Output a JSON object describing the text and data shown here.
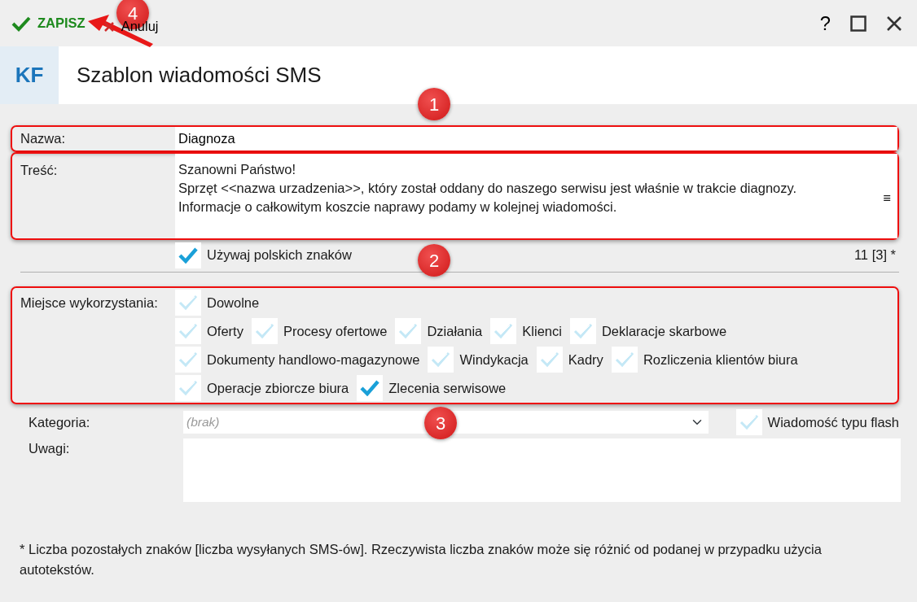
{
  "toolbar": {
    "save": "ZAPISZ",
    "cancel": "Anuluj",
    "help": "?"
  },
  "header": {
    "badge": "KF",
    "title": "Szablon wiadomości SMS"
  },
  "form": {
    "name": {
      "label": "Nazwa:",
      "value": "Diagnoza",
      "framed": true
    },
    "content": {
      "label": "Treść:",
      "lines": [
        "Szanowni Państwo!",
        "Sprzęt <<nazwa urzadzenia>>, który został oddany do naszego serwisu jest właśnie w trakcie diagnozy.",
        "Informacje o całkowitym koszcie naprawy podamy w kolejnej wiadomości."
      ],
      "menu_glyph": "≡",
      "framed": true
    },
    "polish_chars": {
      "label": "Używaj polskich znaków",
      "checked": true
    },
    "counter": "11 [3] *",
    "usage": {
      "label": "Miejsce wykorzystania:",
      "framed": true,
      "lines": [
        {
          "options": [
            {
              "label": "Dowolne",
              "checked": false
            }
          ]
        },
        {
          "options": [
            {
              "label": "Oferty",
              "checked": false
            },
            {
              "label": "Procesy ofertowe",
              "checked": false
            },
            {
              "label": "Działania",
              "checked": false
            },
            {
              "label": "Klienci",
              "checked": false
            },
            {
              "label": "Deklaracje skarbowe",
              "checked": false
            }
          ]
        },
        {
          "options": [
            {
              "label": "Dokumenty handlowo-magazynowe",
              "checked": false
            },
            {
              "label": "Windykacja",
              "checked": false
            },
            {
              "label": "Kadry",
              "checked": false
            },
            {
              "label": "Rozliczenia klientów biura",
              "checked": false
            }
          ]
        },
        {
          "options": [
            {
              "label": "Operacje zbiorcze biura",
              "checked": false
            },
            {
              "label": "Zlecenia serwisowe",
              "checked": true
            }
          ]
        }
      ]
    },
    "category": {
      "label": "Kategoria:",
      "value": "(brak)"
    },
    "flash": {
      "label": "Wiadomość typu flash",
      "checked": false
    },
    "notes": {
      "label": "Uwagi:"
    }
  },
  "footnote": "* Liczba pozostałych znaków [liczba wysyłanych SMS-ów]. Rzeczywista liczba znaków może się różnić od podanej w przypadku użycia autotekstów.",
  "annotations": [
    {
      "label": "1"
    },
    {
      "label": "2"
    },
    {
      "label": "3"
    },
    {
      "label": "4"
    }
  ]
}
